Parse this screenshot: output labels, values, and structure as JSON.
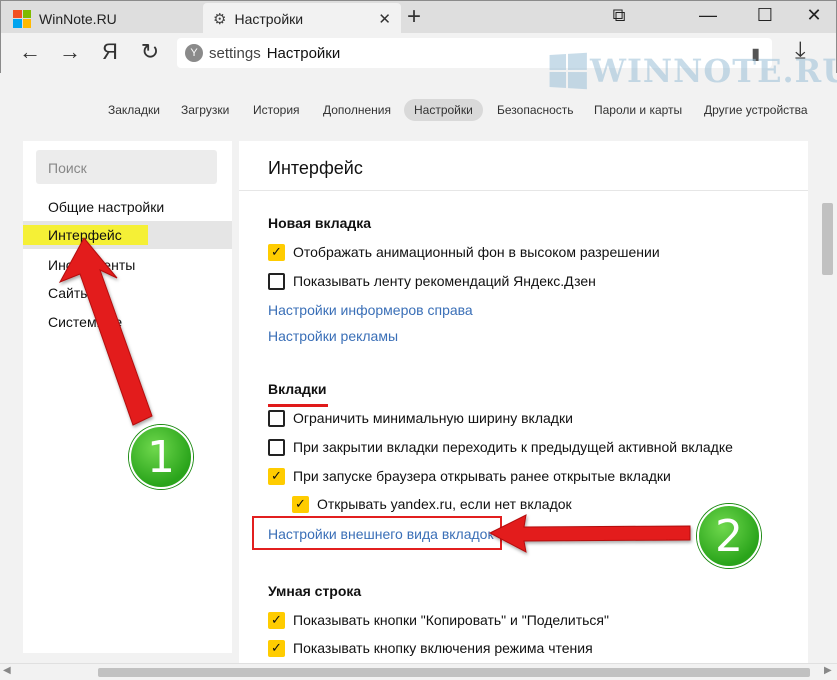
{
  "tabs": [
    {
      "label": "WinNote.RU",
      "icon": "windows-logo-icon"
    },
    {
      "label": "Настройки",
      "icon": "gear-icon"
    }
  ],
  "tab_close": "✕",
  "new_tab": "+",
  "window_controls": {
    "pin": "⧉",
    "minimize": "—",
    "maximize": "☐",
    "close": "✕"
  },
  "address": {
    "scheme": "settings",
    "title": "Настройки",
    "site_icon": "Y"
  },
  "nav": {
    "back": "←",
    "forward": "→",
    "yandex": "Я",
    "reload": "↻",
    "download": "⤓",
    "bookmark": "▮"
  },
  "watermark": "WINNOTE.RU",
  "section_nav": [
    {
      "label": "Закладки",
      "active": false
    },
    {
      "label": "Загрузки",
      "active": false
    },
    {
      "label": "История",
      "active": false
    },
    {
      "label": "Дополнения",
      "active": false
    },
    {
      "label": "Настройки",
      "active": true
    },
    {
      "label": "Безопасность",
      "active": false
    },
    {
      "label": "Пароли и карты",
      "active": false
    },
    {
      "label": "Другие устройства",
      "active": false
    }
  ],
  "sidebar": {
    "search_placeholder": "Поиск",
    "items": [
      {
        "label": "Общие настройки"
      },
      {
        "label": "Интерфейс"
      },
      {
        "label": "Инструменты"
      },
      {
        "label": "Сайты"
      },
      {
        "label": "Системные"
      }
    ]
  },
  "main": {
    "title": "Интерфейс",
    "new_tab": {
      "heading": "Новая вкладка",
      "options": [
        {
          "label": "Отображать анимационный фон в высоком разрешении",
          "checked": true
        },
        {
          "label": "Показывать ленту рекомендаций Яндекс.Дзен",
          "checked": false
        }
      ],
      "links": [
        "Настройки информеров справа",
        "Настройки рекламы"
      ]
    },
    "tabs_section": {
      "heading": "Вкладки",
      "options": [
        {
          "label": "Ограничить минимальную ширину вкладки",
          "checked": false
        },
        {
          "label": "При закрытии вкладки переходить к предыдущей активной вкладке",
          "checked": false
        },
        {
          "label": "При запуске браузера открывать ранее открытые вкладки",
          "checked": true
        },
        {
          "label": "Открывать yandex.ru, если нет вкладок",
          "checked": true
        }
      ],
      "link": "Настройки внешнего вида вкладок"
    },
    "smart_bar": {
      "heading": "Умная строка",
      "options": [
        {
          "label": "Показывать кнопки \"Копировать\" и \"Поделиться\"",
          "checked": true
        },
        {
          "label": "Показывать кнопку включения режима чтения",
          "checked": true
        }
      ]
    }
  },
  "annotations": {
    "badge1": "1",
    "badge2": "2"
  },
  "colors": {
    "accent_red": "#e01a1a",
    "check_yellow": "#ffcc00",
    "highlight_yellow": "#f5f036",
    "link_blue": "#3a6fb7",
    "badge_green": "#2aa41b"
  },
  "icons": {
    "check": "✓"
  }
}
